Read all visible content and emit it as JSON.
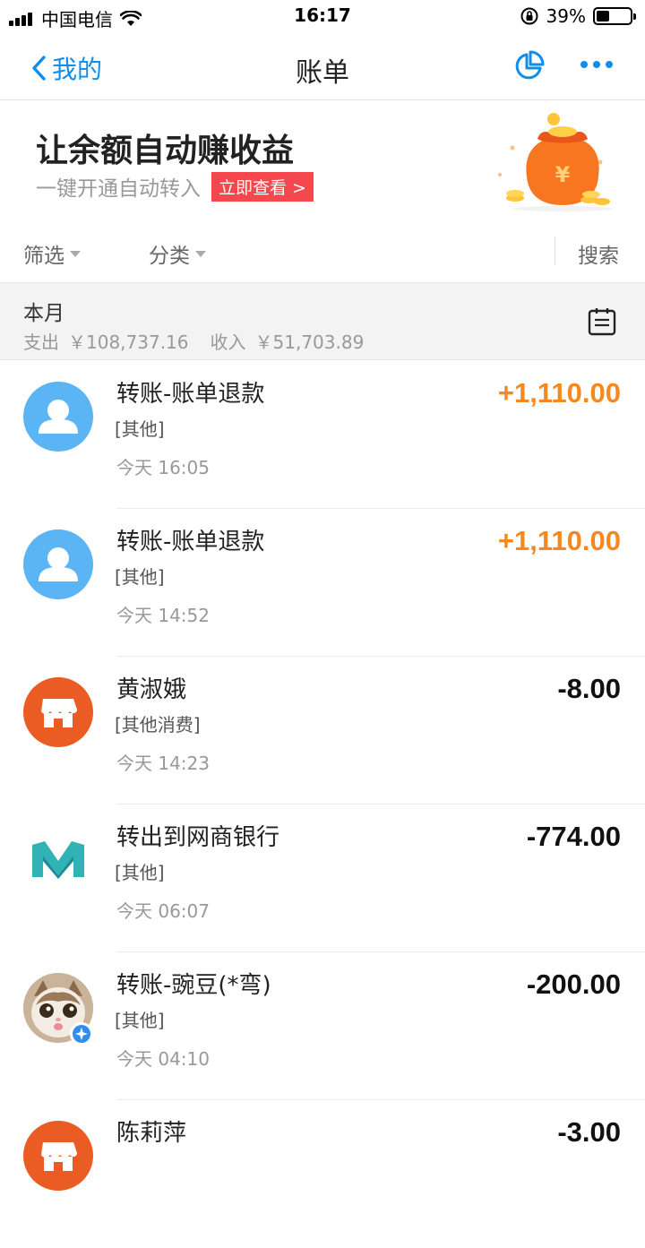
{
  "status_bar": {
    "carrier": "中国电信",
    "time": "16:17",
    "battery_pct": "39%",
    "battery_level": 0.39
  },
  "nav": {
    "back_label": "我的",
    "title": "账单"
  },
  "banner": {
    "title": "让余额自动赚收益",
    "subtitle": "一键开通自动转入",
    "button_label": "立即查看 >"
  },
  "filter_bar": {
    "filter_label": "筛选",
    "category_label": "分类",
    "search_label": "搜索"
  },
  "month": {
    "label": "本月",
    "expense_label": "支出",
    "expense_value": "￥108,737.16",
    "income_label": "收入",
    "income_value": "￥51,703.89"
  },
  "transactions": [
    {
      "title": "转账-账单退款",
      "category": "[其他]",
      "time": "今天  16:05",
      "amount": "+1,110.00",
      "avatar": "person-icon"
    },
    {
      "title": "转账-账单退款",
      "category": "[其他]",
      "time": "今天  14:52",
      "amount": "+1,110.00",
      "avatar": "person-icon"
    },
    {
      "title": "黄淑娥",
      "category": "[其他消费]",
      "time": "今天  14:23",
      "amount": "-8.00",
      "avatar": "shop-icon"
    },
    {
      "title": "转出到网商银行",
      "category": "[其他]",
      "time": "今天  06:07",
      "amount": "-774.00",
      "avatar": "mybank-logo"
    },
    {
      "title": "转账-豌豆(*弯)",
      "category": "[其他]",
      "time": "今天  04:10",
      "amount": "-200.00",
      "avatar": "cat-photo"
    },
    {
      "title": "陈莉萍",
      "category": "",
      "time": "",
      "amount": "-3.00",
      "avatar": "shop-icon"
    }
  ],
  "colors": {
    "accent": "#108ee9",
    "income": "#f5891f",
    "banner_button": "#f5474e",
    "shop_avatar": "#ea5c24",
    "person_avatar": "#5bb5f5"
  }
}
